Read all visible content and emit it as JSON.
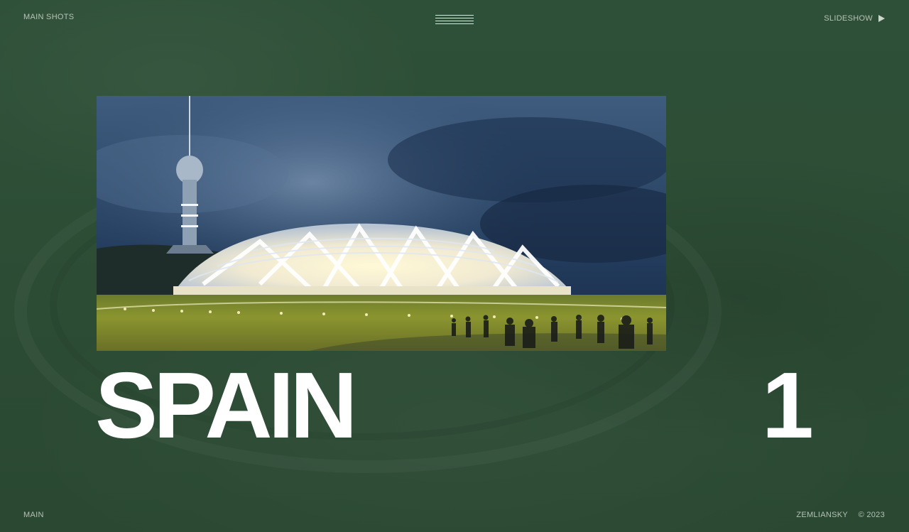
{
  "header": {
    "main_shots": "MAIN SHOTS",
    "slideshow": "SLIDESHOW"
  },
  "footer": {
    "main": "MAIN",
    "brand": "ZEMLIANSKY",
    "copyright": "© 2023"
  },
  "slide": {
    "title": "SPAIN",
    "number": "1",
    "image_subject": "stadium-dome-at-night"
  },
  "icons": {
    "menu": "hamburger-menu-icon",
    "play": "play-icon"
  },
  "colors": {
    "background": "#2f4f36",
    "text": "#ffffff",
    "muted_text": "#cfd9cf"
  }
}
